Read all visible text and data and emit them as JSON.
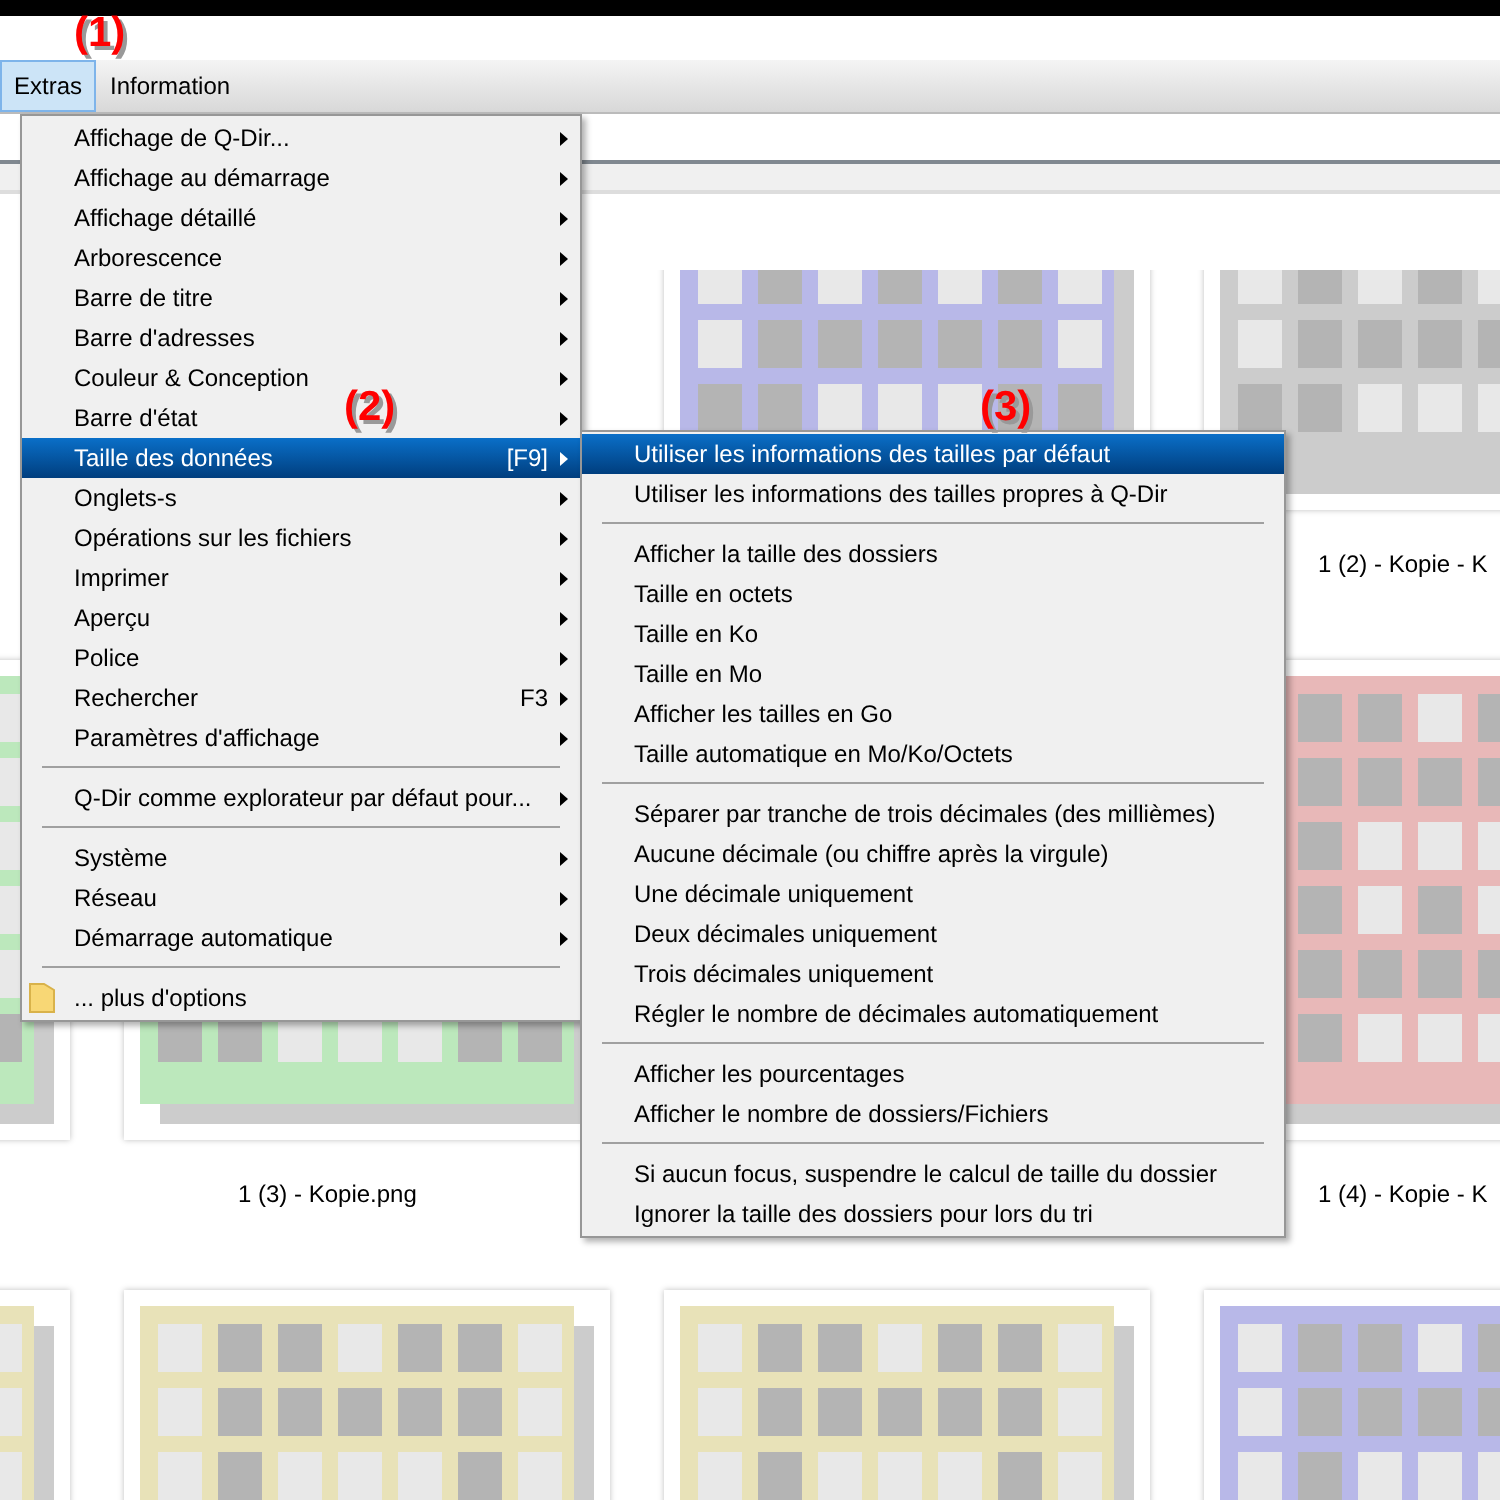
{
  "menubar": [
    {
      "label": "Extras",
      "selected": true
    },
    {
      "label": "Information",
      "selected": false
    }
  ],
  "thumbnails": [
    [
      {
        "kind": "covered"
      },
      {
        "kind": "covered"
      },
      {
        "kind": "tile",
        "color": "#b8b8e8"
      },
      {
        "kind": "tile",
        "color": "#cccccc",
        "label": "1 (2) - Kopie - K"
      }
    ],
    [
      {
        "kind": "tile",
        "color": "#bce8bc"
      },
      {
        "kind": "tile",
        "color": "#bce8bc",
        "label": "1 (3) - Kopie.png"
      },
      {
        "kind": "covered"
      },
      {
        "kind": "tile",
        "color": "#e8b8b8",
        "label": "1 (4) - Kopie - K"
      }
    ],
    [
      {
        "kind": "tile",
        "color": "#e8e2b8"
      },
      {
        "kind": "tile",
        "color": "#e8e2b8"
      },
      {
        "kind": "tile",
        "color": "#e8e2b8"
      },
      {
        "kind": "tile",
        "color": "#b8b8e8"
      }
    ]
  ],
  "main_menu": [
    {
      "kind": "item",
      "label": "Affichage de Q-Dir...",
      "submenu": true,
      "selected": false
    },
    {
      "kind": "item",
      "label": "Affichage au démarrage",
      "submenu": true,
      "selected": false
    },
    {
      "kind": "item",
      "label": "Affichage détaillé",
      "submenu": true,
      "selected": false
    },
    {
      "kind": "item",
      "label": "Arborescence",
      "submenu": true,
      "selected": false
    },
    {
      "kind": "item",
      "label": "Barre de titre",
      "submenu": true,
      "selected": false
    },
    {
      "kind": "item",
      "label": "Barre d'adresses",
      "submenu": true,
      "selected": false
    },
    {
      "kind": "item",
      "label": "Couleur & Conception",
      "submenu": true,
      "selected": false
    },
    {
      "kind": "item",
      "label": "Barre d'état",
      "submenu": true,
      "selected": false
    },
    {
      "kind": "item",
      "label": "Taille des données",
      "shortcut": "[F9]",
      "submenu": true,
      "selected": true
    },
    {
      "kind": "item",
      "label": "Onglets-s",
      "submenu": true,
      "selected": false
    },
    {
      "kind": "item",
      "label": "Opérations sur les fichiers",
      "submenu": true,
      "selected": false
    },
    {
      "kind": "item",
      "label": "Imprimer",
      "submenu": true,
      "selected": false
    },
    {
      "kind": "item",
      "label": "Aperçu",
      "submenu": true,
      "selected": false
    },
    {
      "kind": "item",
      "label": "Police",
      "submenu": true,
      "selected": false
    },
    {
      "kind": "item",
      "label": "Rechercher",
      "shortcut": "F3",
      "submenu": true,
      "selected": false
    },
    {
      "kind": "item",
      "label": "Paramètres d'affichage",
      "submenu": true,
      "selected": false
    },
    {
      "kind": "separator"
    },
    {
      "kind": "item",
      "label": "Q-Dir comme explorateur par défaut pour...",
      "submenu": true,
      "selected": false
    },
    {
      "kind": "separator"
    },
    {
      "kind": "item",
      "label": "Système",
      "submenu": true,
      "selected": false
    },
    {
      "kind": "item",
      "label": "Réseau",
      "submenu": true,
      "selected": false
    },
    {
      "kind": "item",
      "label": "Démarrage automatique",
      "submenu": true,
      "selected": false
    },
    {
      "kind": "separator"
    },
    {
      "kind": "folder",
      "label": "... plus d'options",
      "submenu": false,
      "selected": false
    }
  ],
  "sub_menu": [
    {
      "kind": "item",
      "label": "Utiliser les informations des tailles par défaut",
      "selected": true
    },
    {
      "kind": "item",
      "label": "Utiliser les informations des tailles propres à Q-Dir",
      "selected": false
    },
    {
      "kind": "separator"
    },
    {
      "kind": "item",
      "label": "Afficher la taille des dossiers",
      "selected": false
    },
    {
      "kind": "item",
      "label": "Taille en octets",
      "selected": false
    },
    {
      "kind": "item",
      "label": "Taille en Ko",
      "selected": false
    },
    {
      "kind": "item",
      "label": "Taille en Mo",
      "selected": false
    },
    {
      "kind": "item",
      "label": "Afficher les tailles en Go",
      "selected": false
    },
    {
      "kind": "item",
      "label": "Taille automatique en Mo/Ko/Octets",
      "selected": false
    },
    {
      "kind": "separator"
    },
    {
      "kind": "item",
      "label": "Séparer par tranche de trois décimales (des millièmes)",
      "selected": false
    },
    {
      "kind": "item",
      "label": "Aucune décimale (ou chiffre après la virgule)",
      "selected": false
    },
    {
      "kind": "item",
      "label": "Une décimale uniquement",
      "selected": false
    },
    {
      "kind": "item",
      "label": "Deux décimales uniquement",
      "selected": false
    },
    {
      "kind": "item",
      "label": "Trois décimales uniquement",
      "selected": false
    },
    {
      "kind": "item",
      "label": "Régler le nombre de décimales automatiquement",
      "selected": false
    },
    {
      "kind": "separator"
    },
    {
      "kind": "item",
      "label": "Afficher les pourcentages",
      "selected": false
    },
    {
      "kind": "item",
      "label": "Afficher le nombre de dossiers/Fichiers",
      "selected": false
    },
    {
      "kind": "separator"
    },
    {
      "kind": "item",
      "label": "Si aucun focus, suspendre le calcul de taille du dossier",
      "selected": false
    },
    {
      "kind": "item",
      "label": "Ignorer la taille des dossiers pour lors du tri",
      "selected": false
    }
  ],
  "annotations": [
    "(1)",
    "(2)",
    "(3)"
  ]
}
